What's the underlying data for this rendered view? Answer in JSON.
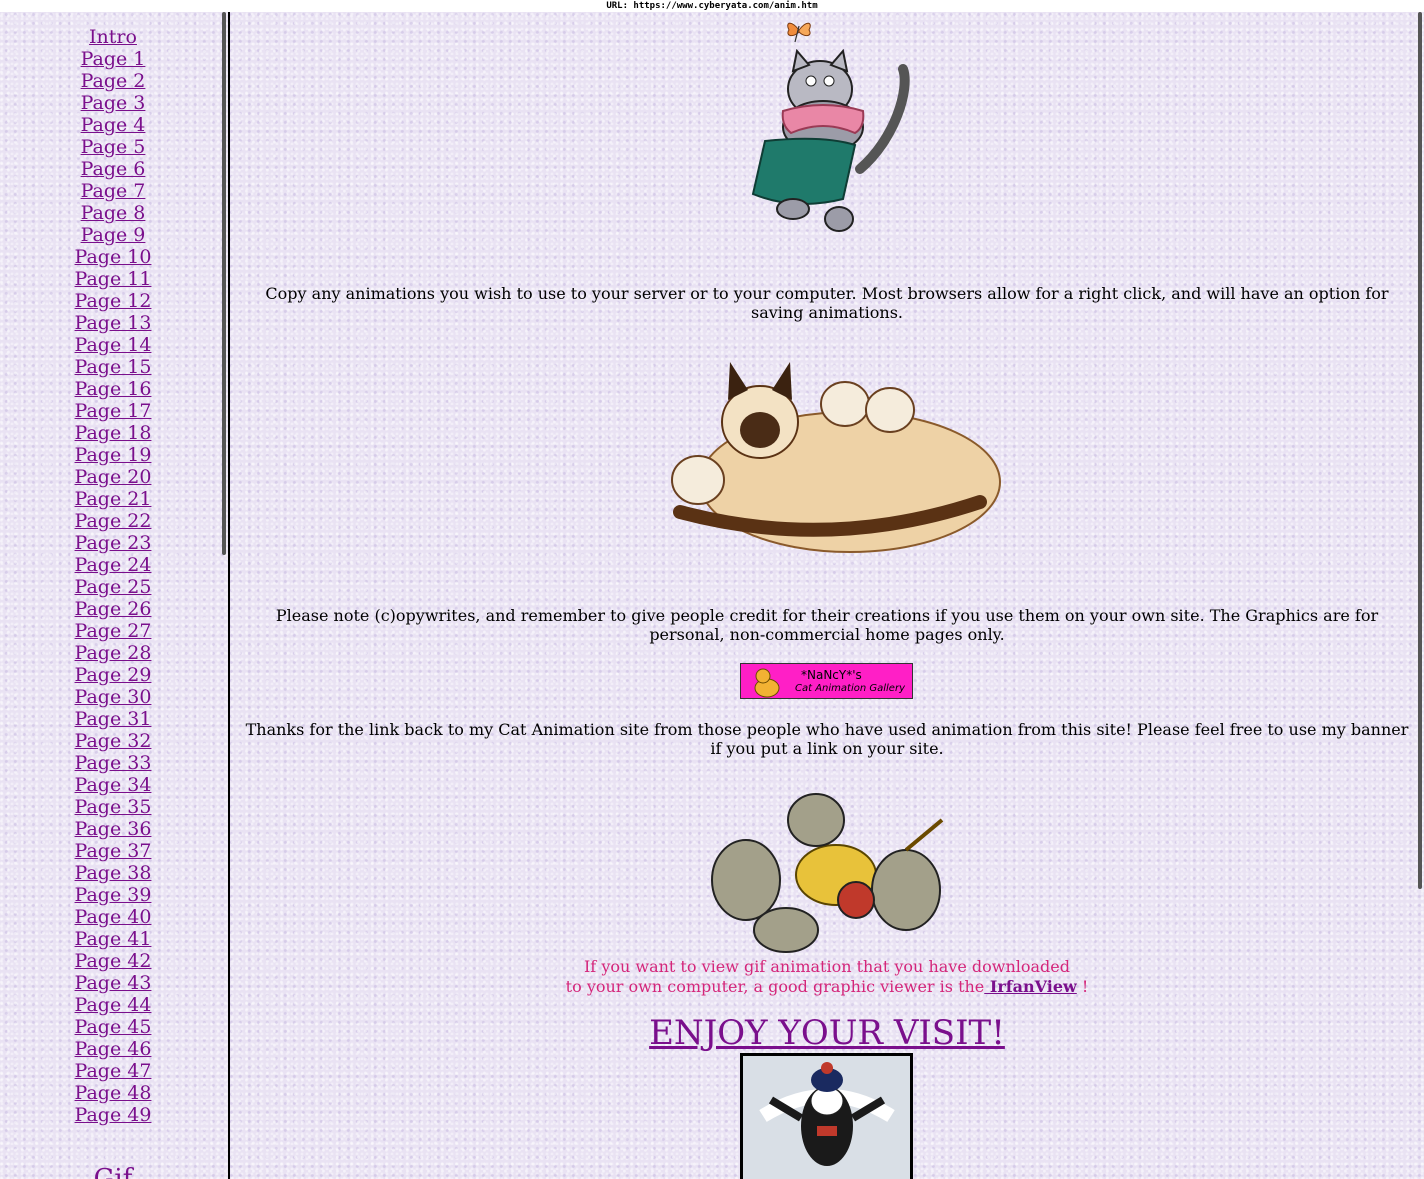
{
  "url_bar": "URL: https://www.cyberyata.com/anim.htm",
  "nav": {
    "items": [
      "Intro",
      "Page 1",
      "Page 2",
      "Page 3",
      "Page 4",
      "Page 5",
      "Page 6",
      "Page 7",
      "Page 8",
      "Page 9",
      "Page 10",
      "Page 11",
      "Page 12",
      "Page 13",
      "Page 14",
      "Page 15",
      "Page 16",
      "Page 17",
      "Page 18",
      "Page 19",
      "Page 20",
      "Page 21",
      "Page 22",
      "Page 23",
      "Page 24",
      "Page 25",
      "Page 26",
      "Page 27",
      "Page 28",
      "Page 29",
      "Page 30",
      "Page 31",
      "Page 32",
      "Page 33",
      "Page 34",
      "Page 35",
      "Page 36",
      "Page 37",
      "Page 38",
      "Page 39",
      "Page 40",
      "Page 41",
      "Page 42",
      "Page 43",
      "Page 44",
      "Page 45",
      "Page 46",
      "Page 47",
      "Page 48",
      "Page 49"
    ],
    "next_heading": "Gif"
  },
  "main": {
    "copy_text": "Copy any animations you wish to use to your server or to your computer. Most browsers allow for a right click, and will have an option for saving animations.",
    "note_text": "Please note (c)opywrites, and remember to give people credit for their creations if you use them on your own site. The Graphics are for personal, non-commercial home pages only.",
    "banner_line1": "*NaNcY*'s",
    "banner_line2": "Cat Animation Gallery",
    "thanks_text": "Thanks for the link back to my Cat Animation site from those people who have used animation from this site! Please feel free to use my banner if you put a link on your site.",
    "viewer_line1": "If you want to view gif animation that you have downloaded",
    "viewer_line2": "to your own computer, a good graphic viewer is the",
    "viewer_link": " IrfanView",
    "viewer_end": " !",
    "enjoy": "ENJOY YOUR VISIT!"
  },
  "colors": {
    "link": "#7a0f8c",
    "pink_text": "#d4267a",
    "banner": "#ff1fc6",
    "background": "#e9e2f3"
  }
}
